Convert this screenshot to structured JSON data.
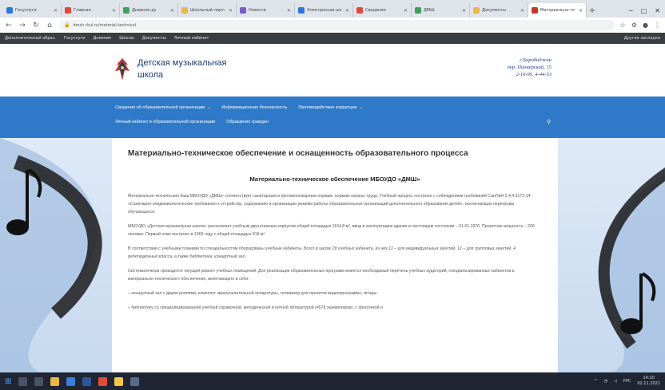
{
  "browser": {
    "tabs": [
      {
        "label": "Госуслуги",
        "active": false
      },
      {
        "label": "Главная",
        "active": false
      },
      {
        "label": "Дневник.ру",
        "active": false
      },
      {
        "label": "Школьный портал",
        "active": false
      },
      {
        "label": "Новости",
        "active": false
      },
      {
        "label": "Электронная школа",
        "active": false
      },
      {
        "label": "Сведения",
        "active": false
      },
      {
        "label": "ДМШ",
        "active": false
      },
      {
        "label": "Документы",
        "active": false
      },
      {
        "label": "Материально-тех.",
        "active": true
      }
    ],
    "address": "dmsh.rkul.ru/material-technical",
    "bookmarks": [
      "Дополнительный образ.",
      "Госуслуги",
      "Дневник",
      "Школы",
      "Документы",
      "Личный кабинет"
    ],
    "bookmarks_right": "Другие закладки"
  },
  "site": {
    "name_line1": "Детская музыкальная",
    "name_line2": "школа",
    "contacts": {
      "line1": "г.Биробиджан",
      "line2": "пер. Пионерский, 15",
      "line3": "2-16-95, 4-44-53"
    }
  },
  "nav": {
    "row1": [
      {
        "label": "Сведения об образовательной организации",
        "caret": true
      },
      {
        "label": "Информационная безопасность",
        "caret": false
      },
      {
        "label": "Противодействие коррупции",
        "caret": true
      }
    ],
    "row2": [
      {
        "label": "Личный кабинет в образовательной организации",
        "caret": false
      },
      {
        "label": "Обращения граждан",
        "caret": false
      }
    ]
  },
  "content": {
    "page_title": "Материально-техническое обеспечение и оснащенность образовательного процесса",
    "subtitle": "Материально-техническое обеспечение МБОУДО «ДМШ»",
    "paragraphs": [
      "Материально-техническая база МБОУДО «ДМШ» соответствует санитарным и противопожарным нормам, нормам охраны труда. Учебный процесс построен с соблюдением требований СанПиН 2.4.4.3172-14 «Санитарно-эпидемиологические требования к устройству, содержанию и организации режима работы образовательных организаций дополнительного образования детей», исключающих перегрузки обучающихся.",
      "МБОУДО «Детская музыкальная школа» располагает учебным двухэтажным корпусом общей площадью 1164,8 м², ввод в эксплуатацию здания в настоящем состоянии – 01.01.1976. Проектная мощность – 200 человек. Первый этаж построен в 1965 году с общей площадью 818 м².",
      "В соответствии с учебными планами по специальностям оборудованы учебные кабинеты. Всего в школе 28 учебных кабинета, из них 12 – для индивидуальных занятий, 12 – для групповых занятий, 4 репетиционных класса, а также библиотека, концертный зал.",
      "Систематически проводится текущий ремонт учебных помещений. Для реализации образовательных программ имеется необходимый перечень учебных аудиторий, специализированных кабинетов и материально-технического обеспечения, включающего в себя:",
      "– концертный зал с двумя роялями, комплект звукоусилительной аппаратуры, телевизор для проектов видеопрограммы, гитары",
      "– библиотеку со специализированной учебной справочной, методической и нотной литературой (4578 экземпляров), с фонотекой и"
    ]
  },
  "taskbar": {
    "time": "14:20",
    "date": "02.11.2021",
    "lang": "РУС"
  },
  "colors": {
    "nav_blue": "#2f79c9",
    "title_blue": "#1d3c6e"
  }
}
